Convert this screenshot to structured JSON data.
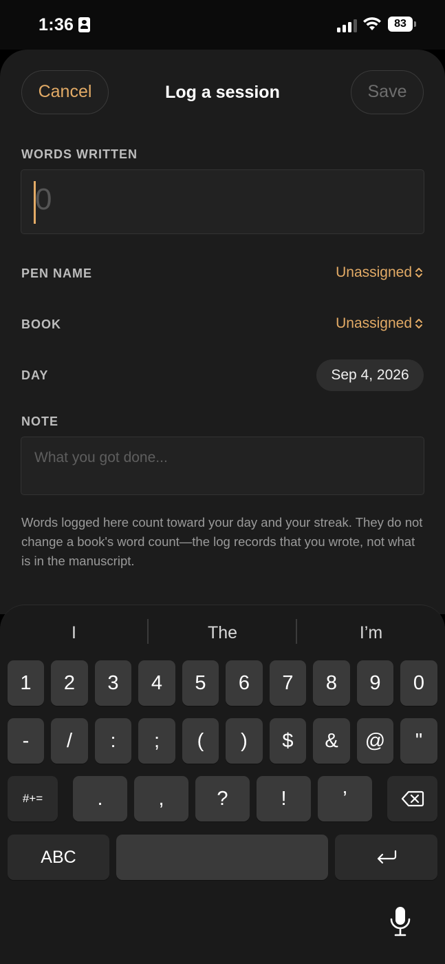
{
  "status": {
    "time": "1:36",
    "battery": "83"
  },
  "header": {
    "cancel": "Cancel",
    "title": "Log a session",
    "save": "Save"
  },
  "form": {
    "words_label": "WORDS WRITTEN",
    "words_placeholder": "0",
    "pen_label": "PEN NAME",
    "pen_value": "Unassigned",
    "book_label": "BOOK",
    "book_value": "Unassigned",
    "day_label": "DAY",
    "day_value": "Sep 4, 2026",
    "note_label": "NOTE",
    "note_placeholder": "What you got done...",
    "helper": "Words logged here count toward your day and your streak. They do not change a book's word count—the log records that you wrote, not what is in the manuscript."
  },
  "keyboard": {
    "suggestions": [
      "I",
      "The",
      "I’m"
    ],
    "row1": [
      "1",
      "2",
      "3",
      "4",
      "5",
      "6",
      "7",
      "8",
      "9",
      "0"
    ],
    "row2": [
      "-",
      "/",
      ":",
      ";",
      "(",
      ")",
      "$",
      "&",
      "@",
      "\""
    ],
    "row3": [
      "#+=",
      ".",
      ",",
      "?",
      "!",
      "’"
    ],
    "abc": "ABC"
  },
  "colors": {
    "accent": "#e3ab66",
    "sheet": "#1c1c1c"
  },
  "icons": [
    "id-card-icon",
    "signal-icon",
    "wifi-icon",
    "battery-icon",
    "chevron-updown-icon",
    "backspace-icon",
    "return-icon",
    "mic-icon"
  ]
}
